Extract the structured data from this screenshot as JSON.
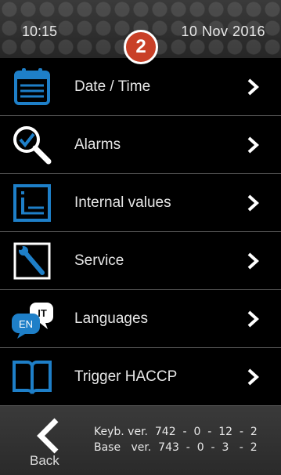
{
  "header": {
    "time": "10:15",
    "date": "10 Nov 2016",
    "badge": "2"
  },
  "menu": {
    "items": [
      {
        "label": "Date / Time",
        "icon": "calendar-icon"
      },
      {
        "label": "Alarms",
        "icon": "alarm-search-icon"
      },
      {
        "label": "Internal values",
        "icon": "internal-values-icon"
      },
      {
        "label": "Service",
        "icon": "wrench-icon"
      },
      {
        "label": "Languages",
        "icon": "languages-icon",
        "icon_text_1": "EN",
        "icon_text_2": "IT"
      },
      {
        "label": "Trigger HACCP",
        "icon": "book-icon"
      }
    ]
  },
  "footer": {
    "back_label": "Back",
    "keyb_version": "Keyb. ver.  742  -  0  -  12  -  2",
    "base_version": "Base   ver.  743  -  0  -  3   -  2"
  },
  "colors": {
    "accent_blue": "#1e7fc8",
    "badge_red": "#c94027",
    "background": "#000000"
  }
}
